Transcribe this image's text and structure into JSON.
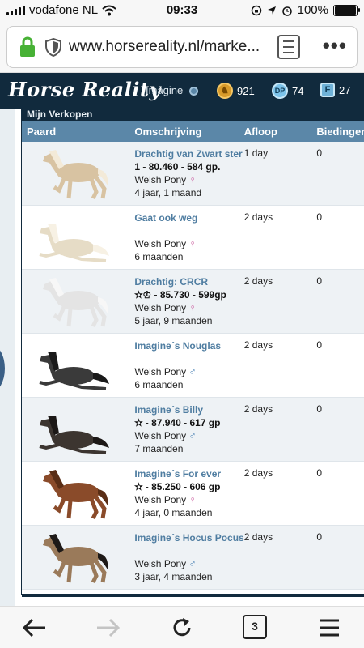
{
  "status": {
    "carrier": "vodafone NL",
    "time": "09:33",
    "battery": "100%"
  },
  "browser": {
    "url": "www.horsereality.nl/marke...",
    "tab_count": "3"
  },
  "header": {
    "logo": "Horse Reality",
    "username": "Imagine",
    "coins": "921",
    "dp_label": "DP",
    "dp": "74",
    "f_label": "F",
    "f": "27"
  },
  "panel": {
    "title": "Mijn Verkopen"
  },
  "table": {
    "columns": {
      "paard": "Paard",
      "omschrijving": "Omschrijving",
      "afloop": "Afloop",
      "biedingen": "Biedingen"
    },
    "rows": [
      {
        "name": "Drachtig van Zwart ster",
        "score": "1 - 80.460 - 584 gp.",
        "breed": "Welsh Pony",
        "gender": "♀",
        "age": "4 jaar, 1 maand",
        "afloop": "1 day",
        "bids": "0",
        "color": "#d8c3a2",
        "mane": "#f3ead8",
        "pose": "stand"
      },
      {
        "name": "Gaat ook weg",
        "score": "",
        "breed": "Welsh Pony",
        "gender": "♀",
        "age": "6 maanden",
        "afloop": "2 days",
        "bids": "0",
        "color": "#e6dcc6",
        "mane": "#f7f1e4",
        "pose": "lie"
      },
      {
        "name": "Drachtig: CRCR",
        "score": "✫♔ - 85.730 - 599gp",
        "breed": "Welsh Pony",
        "gender": "♀",
        "age": "5 jaar, 9 maanden",
        "afloop": "2 days",
        "bids": "0",
        "color": "#e4e4e4",
        "mane": "#f7f7f7",
        "pose": "stand"
      },
      {
        "name": "Imagine´s Nouglas",
        "score": "",
        "breed": "Welsh Pony",
        "gender": "♂",
        "age": "6 maanden",
        "afloop": "2 days",
        "bids": "0",
        "color": "#3a3a3a",
        "mane": "#1a1a1a",
        "pose": "lie"
      },
      {
        "name": "Imagine´s Billy",
        "score": "✫ - 87.940 - 617 gp",
        "breed": "Welsh Pony",
        "gender": "♂",
        "age": "7 maanden",
        "afloop": "2 days",
        "bids": "0",
        "color": "#3c3530",
        "mane": "#1c1816",
        "pose": "lie"
      },
      {
        "name": "Imagine´s For ever",
        "score": "✫ - 85.250 - 606 gp",
        "breed": "Welsh Pony",
        "gender": "♀",
        "age": "4 jaar, 0 maanden",
        "afloop": "2 days",
        "bids": "0",
        "color": "#8a4b2a",
        "mane": "#5a2e16",
        "pose": "stand"
      },
      {
        "name": "Imagine´s Hocus Pocus",
        "score": "",
        "breed": "Welsh Pony",
        "gender": "♂",
        "age": "3 jaar, 4 maanden",
        "afloop": "2 days",
        "bids": "0",
        "color": "#9a7a5a",
        "mane": "#1e1a18",
        "pose": "stand"
      }
    ]
  }
}
